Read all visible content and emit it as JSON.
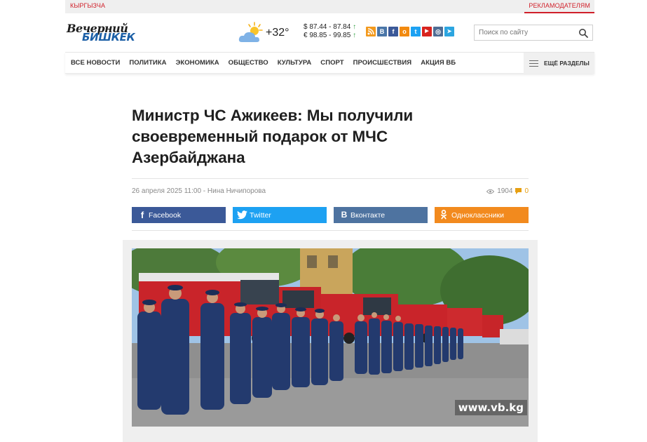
{
  "topbar": {
    "lang": "КЫРГЫЗЧА",
    "advertisers": "РЕКЛАМОДАТЕЛЯМ"
  },
  "logo": {
    "line1": "Вечерний",
    "line2": "БИШКЕК"
  },
  "weather": {
    "temp": "+32°",
    "icon": "sun-cloud-icon"
  },
  "currency": {
    "usd": "$ 87.44 - 87.84",
    "eur": "€ 98.85 - 99.85",
    "trend": "↑"
  },
  "socials": [
    {
      "name": "rss",
      "glyph": "",
      "color": "#f39a1e"
    },
    {
      "name": "vk",
      "glyph": "B",
      "color": "#4a76a8"
    },
    {
      "name": "facebook",
      "glyph": "f",
      "color": "#3b5998"
    },
    {
      "name": "odnoklassniki",
      "glyph": "o",
      "color": "#f28a10"
    },
    {
      "name": "twitter",
      "glyph": "t",
      "color": "#1da1f2"
    },
    {
      "name": "youtube",
      "glyph": "▶",
      "color": "#d8241f"
    },
    {
      "name": "instagram",
      "glyph": "◎",
      "color": "#4f6d94"
    },
    {
      "name": "telegram",
      "glyph": "➤",
      "color": "#2ca5e0"
    }
  ],
  "search": {
    "placeholder": "Поиск по сайту"
  },
  "nav": {
    "items": [
      "ВСЕ НОВОСТИ",
      "ПОЛИТИКА",
      "ЭКОНОМИКА",
      "ОБЩЕСТВО",
      "КУЛЬТУРА",
      "СПОРТ",
      "ПРОИСШЕСТВИЯ",
      "АКЦИЯ ВБ"
    ],
    "more": "ЕЩЁ РАЗДЕЛЫ"
  },
  "article": {
    "title": "Министр ЧС Ажикеев: Мы получили своевременный подарок от МЧС Азербайджана",
    "date": "26 апреля 2025 11:00",
    "author": "Нина Ничипорова",
    "views": "1904",
    "comments": "0",
    "watermark": "www.vb.kg"
  },
  "share": [
    {
      "label": "Facebook",
      "color": "#3b5998",
      "glyph": "f"
    },
    {
      "label": "Twitter",
      "color": "#1da1f2",
      "glyph": "t"
    },
    {
      "label": "Вконтакте",
      "color": "#4e73a0",
      "glyph": "B"
    },
    {
      "label": "Одноклассники",
      "color": "#f28a1e",
      "glyph": "o"
    }
  ],
  "colors": {
    "accent": "#d0202a",
    "brand_blue": "#1b5fa6"
  }
}
